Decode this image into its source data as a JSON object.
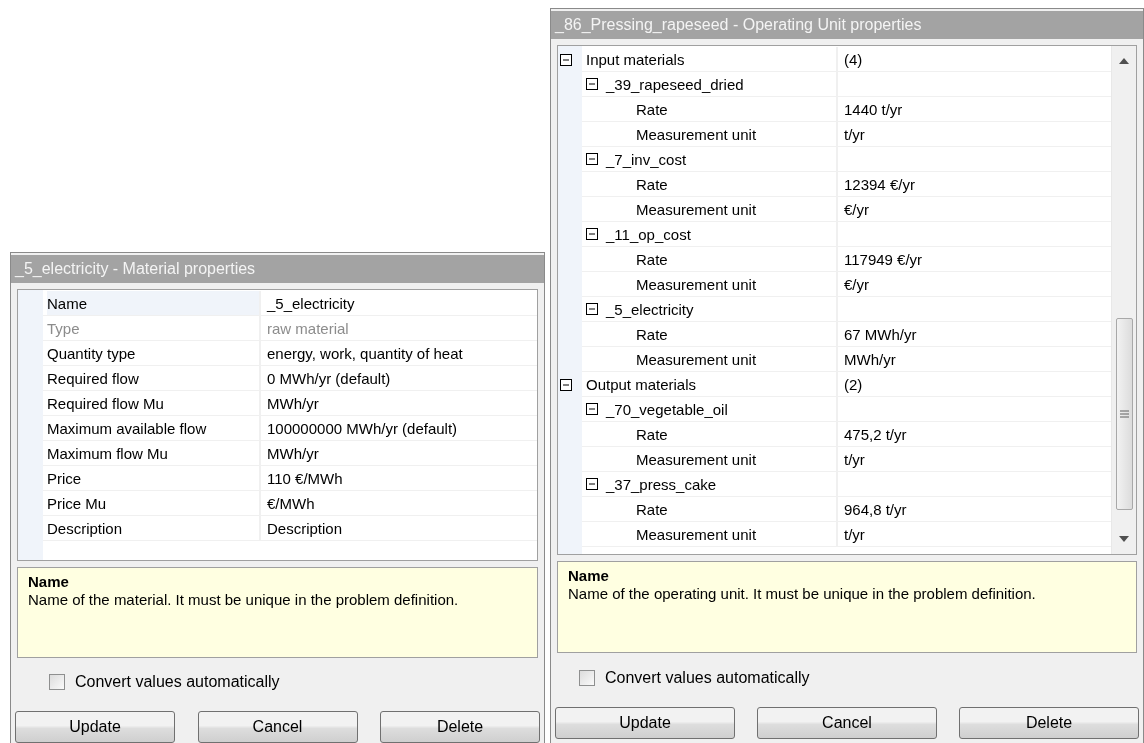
{
  "material_panel": {
    "title": "_5_electricity - Material properties",
    "properties": [
      {
        "label": "Name",
        "value": "_5_electricity",
        "selected": true,
        "disabled": false
      },
      {
        "label": "Type",
        "value": "raw material",
        "selected": false,
        "disabled": true
      },
      {
        "label": "Quantity type",
        "value": "energy, work, quantity of heat",
        "selected": false,
        "disabled": false
      },
      {
        "label": "Required flow",
        "value": "0 MWh/yr (default)",
        "selected": false,
        "disabled": false
      },
      {
        "label": "Required flow Mu",
        "value": "MWh/yr",
        "selected": false,
        "disabled": false
      },
      {
        "label": "Maximum available flow",
        "value": "100000000 MWh/yr (default)",
        "selected": false,
        "disabled": false
      },
      {
        "label": "Maximum flow Mu",
        "value": "MWh/yr",
        "selected": false,
        "disabled": false
      },
      {
        "label": "Price",
        "value": "110 €/MWh",
        "selected": false,
        "disabled": false
      },
      {
        "label": "Price Mu",
        "value": "€/MWh",
        "selected": false,
        "disabled": false
      },
      {
        "label": "Description",
        "value": "Description",
        "selected": false,
        "disabled": false
      }
    ],
    "help": {
      "title": "Name",
      "text": "Name of the material. It must be unique in the problem definition."
    },
    "convert": {
      "label": "Convert values automatically",
      "checked": false
    },
    "buttons": [
      "Update",
      "Cancel",
      "Delete"
    ]
  },
  "operating_unit_panel": {
    "title": "_86_Pressing_rapeseed - Operating Unit properties",
    "tree": [
      {
        "label": "Input materials",
        "value": "(4)",
        "expanded": true,
        "children": [
          {
            "label": "_39_rapeseed_dried",
            "expanded": true,
            "children": [
              {
                "label": "Rate",
                "value": "1440 t/yr"
              },
              {
                "label": "Measurement unit",
                "value": "t/yr"
              }
            ]
          },
          {
            "label": "_7_inv_cost",
            "expanded": true,
            "children": [
              {
                "label": "Rate",
                "value": "12394 €/yr"
              },
              {
                "label": "Measurement unit",
                "value": "€/yr"
              }
            ]
          },
          {
            "label": "_11_op_cost",
            "expanded": true,
            "children": [
              {
                "label": "Rate",
                "value": "117949 €/yr"
              },
              {
                "label": "Measurement unit",
                "value": "€/yr"
              }
            ]
          },
          {
            "label": "_5_electricity",
            "expanded": true,
            "children": [
              {
                "label": "Rate",
                "value": "67 MWh/yr"
              },
              {
                "label": "Measurement unit",
                "value": "MWh/yr"
              }
            ]
          }
        ]
      },
      {
        "label": "Output materials",
        "value": "(2)",
        "expanded": true,
        "children": [
          {
            "label": "_70_vegetable_oil",
            "expanded": true,
            "children": [
              {
                "label": "Rate",
                "value": "475,2 t/yr"
              },
              {
                "label": "Measurement unit",
                "value": "t/yr"
              }
            ]
          },
          {
            "label": "_37_press_cake",
            "expanded": true,
            "children": [
              {
                "label": "Rate",
                "value": "964,8 t/yr"
              },
              {
                "label": "Measurement unit",
                "value": "t/yr"
              }
            ]
          }
        ]
      }
    ],
    "help": {
      "title": "Name",
      "text": "Name of the operating unit. It must be unique in the problem definition."
    },
    "convert": {
      "label": "Convert values automatically",
      "checked": false
    },
    "buttons": [
      "Update",
      "Cancel",
      "Delete"
    ]
  }
}
